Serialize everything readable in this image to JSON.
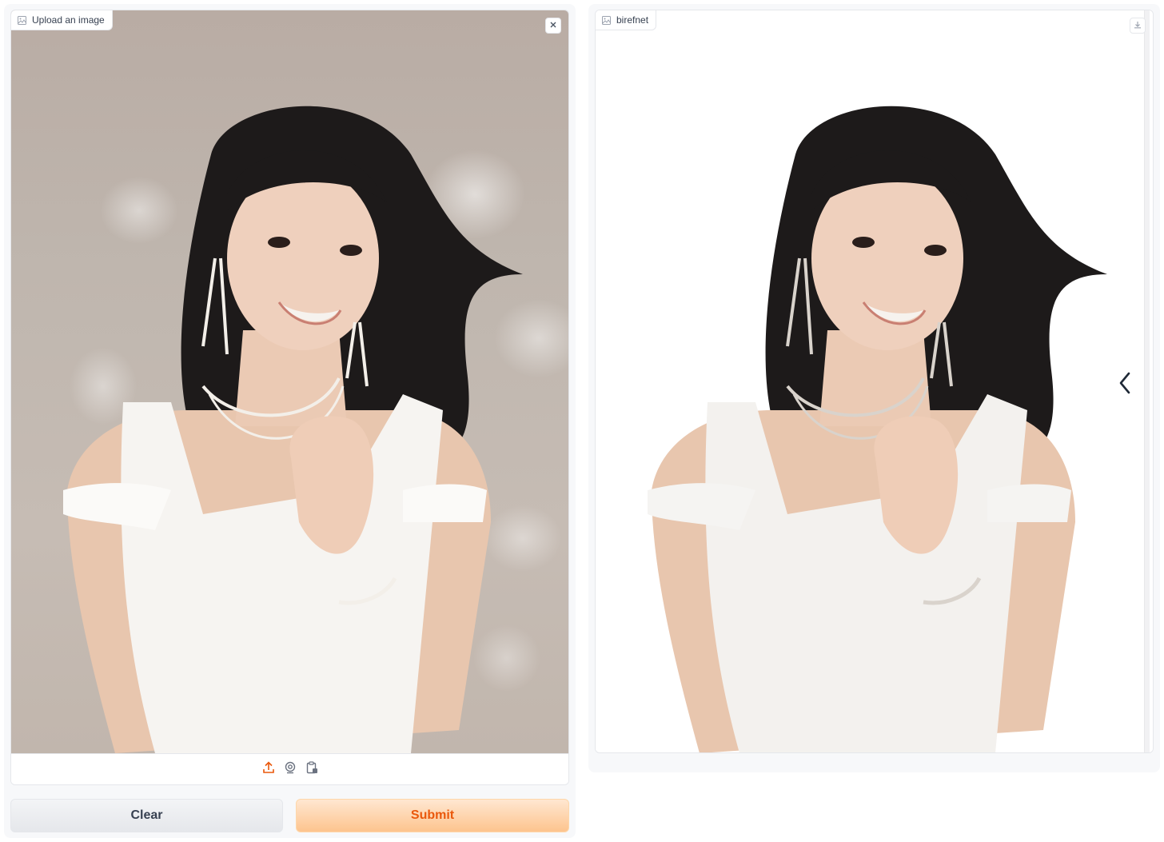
{
  "input": {
    "label": "Upload an image",
    "label_icon": "image-icon",
    "close_icon": "close-icon",
    "sources": [
      {
        "name": "upload",
        "icon": "upload-icon"
      },
      {
        "name": "webcam",
        "icon": "webcam-icon"
      },
      {
        "name": "clipboard",
        "icon": "clipboard-icon"
      }
    ]
  },
  "buttons": {
    "clear_label": "Clear",
    "submit_label": "Submit"
  },
  "output": {
    "label": "birefnet",
    "label_icon": "image-icon",
    "download_icon": "download-icon",
    "nav_icon": "chevron-left-icon"
  },
  "colors": {
    "accent": "#ea580c",
    "submit_bg": "#fdc48e",
    "clear_bg": "#e5e7eb",
    "panel_bg": "#f7f8fa",
    "photo_bg": "#bfb6ae"
  }
}
